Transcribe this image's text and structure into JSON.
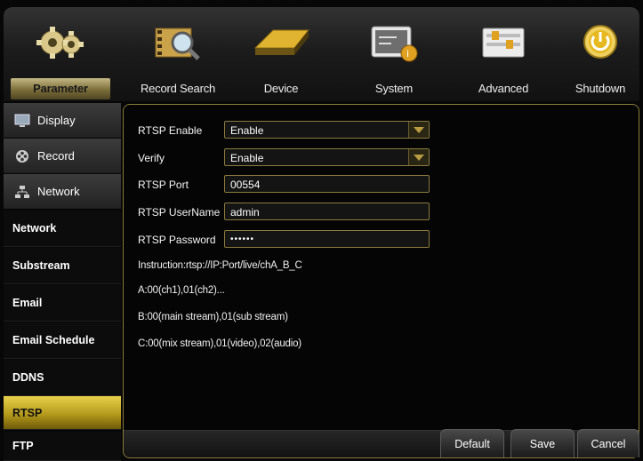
{
  "toolbar": {
    "items": [
      {
        "label": "Parameter",
        "icon": "gears-icon",
        "active": true
      },
      {
        "label": "Record Search",
        "icon": "film-search-icon",
        "active": false
      },
      {
        "label": "Device",
        "icon": "hard-disk-icon",
        "active": false
      },
      {
        "label": "System",
        "icon": "system-info-icon",
        "active": false
      },
      {
        "label": "Advanced",
        "icon": "advanced-settings-icon",
        "active": false
      },
      {
        "label": "Shutdown",
        "icon": "power-icon",
        "active": false
      }
    ]
  },
  "sidebar": {
    "groups": [
      {
        "label": "Display",
        "icon": "monitor-icon"
      },
      {
        "label": "Record",
        "icon": "film-reel-icon"
      },
      {
        "label": "Network",
        "icon": "network-icon"
      }
    ],
    "items": [
      {
        "label": "Network"
      },
      {
        "label": "Substream"
      },
      {
        "label": "Email"
      },
      {
        "label": "Email Schedule"
      },
      {
        "label": "DDNS"
      },
      {
        "label": "RTSP",
        "active": true
      },
      {
        "label": "FTP"
      }
    ]
  },
  "form": {
    "rtsp_enable": {
      "label": "RTSP Enable",
      "value": "Enable"
    },
    "verify": {
      "label": "Verify",
      "value": "Enable"
    },
    "rtsp_port": {
      "label": "RTSP Port",
      "value": "00554"
    },
    "rtsp_username": {
      "label": "RTSP UserName",
      "value": "admin"
    },
    "rtsp_password": {
      "label": "RTSP Password",
      "value": "••••••"
    }
  },
  "instructions": {
    "line1": "Instruction:rtsp://IP:Port/live/chA_B_C",
    "line2": "A:00(ch1),01(ch2)...",
    "line3": "B:00(main stream),01(sub stream)",
    "line4": "C:00(mix stream),01(video),02(audio)"
  },
  "buttons": {
    "default": "Default",
    "save": "Save",
    "cancel": "Cancel"
  },
  "colors": {
    "accent_gold": "#c9b04a",
    "active_menu": "#d9bd2a",
    "border_gold": "#8a7b3c"
  }
}
